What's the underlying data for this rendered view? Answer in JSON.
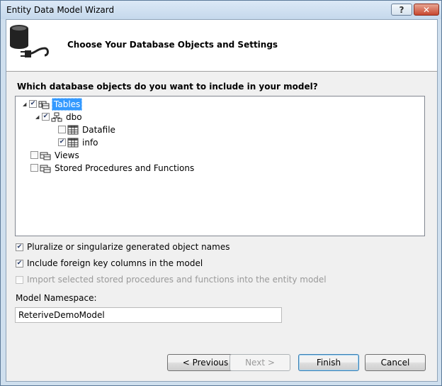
{
  "window": {
    "title": "Entity Data Model Wizard",
    "help_label": "?",
    "close_label": "✕"
  },
  "header": {
    "title": "Choose Your Database Objects and Settings"
  },
  "question": "Which database objects do you want to include in your model?",
  "tree": {
    "tables": {
      "label": "Tables",
      "checked": true,
      "expanded": true,
      "selected": true
    },
    "dbo": {
      "label": "dbo",
      "checked": true,
      "expanded": true
    },
    "datafile": {
      "label": "Datafile",
      "checked": false
    },
    "info": {
      "label": "info",
      "checked": true
    },
    "views": {
      "label": "Views",
      "checked": false
    },
    "procs": {
      "label": "Stored Procedures and Functions",
      "checked": false
    }
  },
  "options": {
    "pluralize": {
      "label": "Pluralize or singularize generated object names",
      "checked": true
    },
    "foreign_keys": {
      "label": "Include foreign key columns in the model",
      "checked": true
    },
    "import_procs": {
      "label": "Import selected stored procedures and functions into the entity model",
      "checked": false,
      "enabled": false
    }
  },
  "namespace": {
    "label": "Model Namespace:",
    "value": "ReteriveDemoModel"
  },
  "buttons": {
    "previous": "< Previous",
    "next": "Next >",
    "finish": "Finish",
    "cancel": "Cancel"
  }
}
